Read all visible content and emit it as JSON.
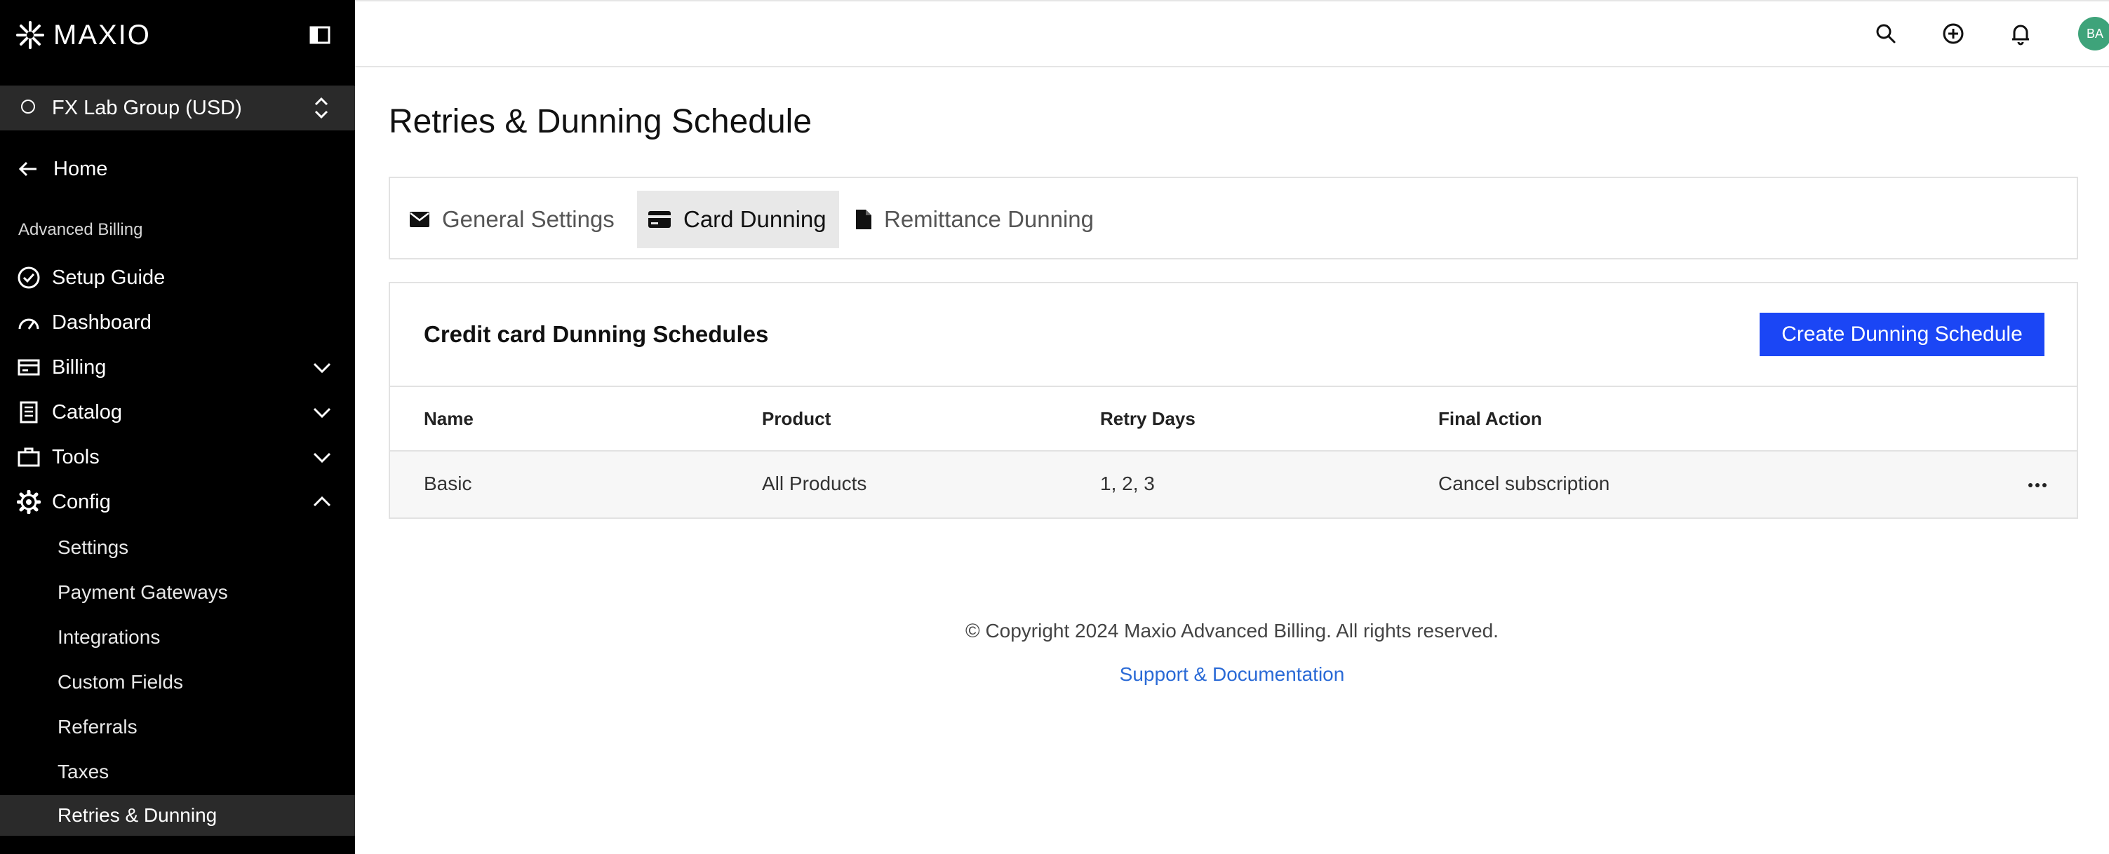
{
  "brand": {
    "name": "MAXIO"
  },
  "account": {
    "name": "FX Lab Group (USD)"
  },
  "sidebar": {
    "home_label": "Home",
    "section_label": "Advanced Billing",
    "items": [
      {
        "label": "Setup Guide"
      },
      {
        "label": "Dashboard"
      },
      {
        "label": "Billing"
      },
      {
        "label": "Catalog"
      },
      {
        "label": "Tools"
      },
      {
        "label": "Config"
      }
    ],
    "config_items": [
      {
        "label": "Settings"
      },
      {
        "label": "Payment Gateways"
      },
      {
        "label": "Integrations"
      },
      {
        "label": "Custom Fields"
      },
      {
        "label": "Referrals"
      },
      {
        "label": "Taxes"
      },
      {
        "label": "Retries & Dunning"
      }
    ]
  },
  "topbar": {
    "avatar_initials": "BA"
  },
  "page": {
    "title": "Retries & Dunning Schedule"
  },
  "tabs": [
    {
      "label": "General Settings",
      "icon": "envelope-icon"
    },
    {
      "label": "Card Dunning",
      "icon": "credit-card-icon"
    },
    {
      "label": "Remittance Dunning",
      "icon": "document-icon"
    }
  ],
  "card": {
    "title": "Credit card Dunning Schedules",
    "create_button": "Create Dunning Schedule"
  },
  "table": {
    "headers": [
      "Name",
      "Product",
      "Retry Days",
      "Final Action"
    ],
    "rows": [
      {
        "name": "Basic",
        "product": "All Products",
        "retry_days": "1, 2, 3",
        "final_action": "Cancel subscription"
      }
    ]
  },
  "footer": {
    "copyright": "© Copyright 2024 Maxio Advanced Billing. All rights reserved.",
    "support_link": "Support & Documentation"
  },
  "colors": {
    "sidebar_bg": "#000000",
    "primary_button": "#1b46f5",
    "link": "#2a6ad6",
    "avatar": "#3ea37a"
  }
}
